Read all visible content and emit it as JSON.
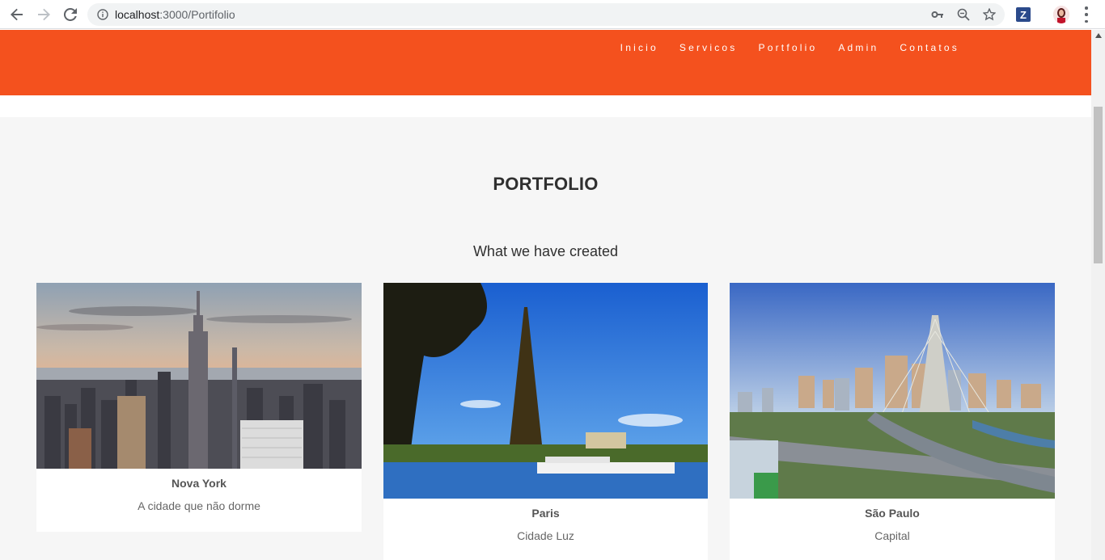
{
  "browser": {
    "url_host": "localhost",
    "url_port_path": ":3000/Portifolio"
  },
  "nav": {
    "items": [
      "Inicio",
      "Servicos",
      "Portfolio",
      "Admin",
      "Contatos"
    ]
  },
  "portfolio": {
    "title": "PORTFOLIO",
    "subtitle": "What we have created",
    "cards": [
      {
        "title": "Nova York",
        "text": "A cidade que não dorme"
      },
      {
        "title": "Paris",
        "text": "Cidade Luz"
      },
      {
        "title": "São Paulo",
        "text": "Capital"
      }
    ]
  },
  "colors": {
    "header": "#f4511e",
    "section_bg": "#f6f6f6"
  }
}
